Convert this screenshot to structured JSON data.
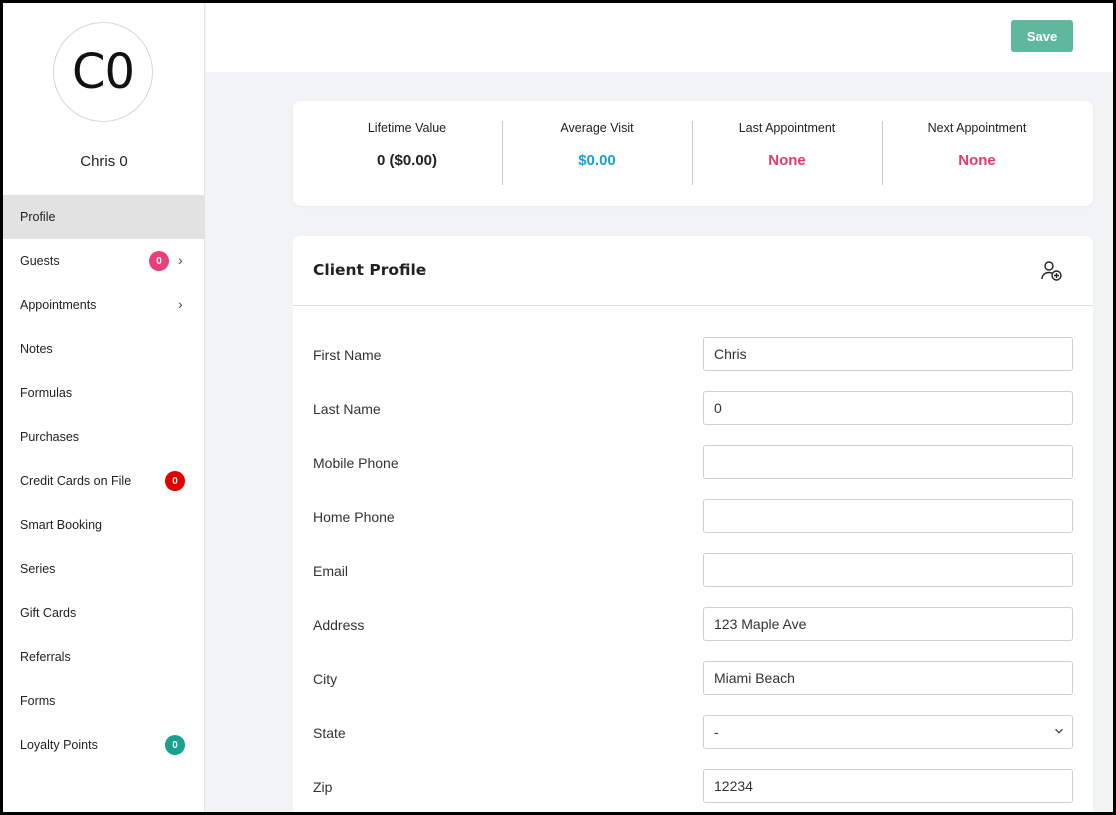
{
  "client": {
    "initials": "C0",
    "name": "Chris 0"
  },
  "sidebar": {
    "items": [
      {
        "label": "Profile"
      },
      {
        "label": "Guests",
        "badge": "0"
      },
      {
        "label": "Appointments"
      },
      {
        "label": "Notes"
      },
      {
        "label": "Formulas"
      },
      {
        "label": "Purchases"
      },
      {
        "label": "Credit Cards on File",
        "badge": "0"
      },
      {
        "label": "Smart Booking"
      },
      {
        "label": "Series"
      },
      {
        "label": "Gift Cards"
      },
      {
        "label": "Referrals"
      },
      {
        "label": "Forms"
      },
      {
        "label": "Loyalty Points",
        "badge": "0"
      }
    ]
  },
  "toolbar": {
    "save_label": "Save"
  },
  "stats": [
    {
      "label": "Lifetime Value",
      "value": "0 ($0.00)",
      "color": "#222222"
    },
    {
      "label": "Average Visit",
      "value": "$0.00",
      "color": "#1aa0d8"
    },
    {
      "label": "Last Appointment",
      "value": "None",
      "color": "#e23b6b"
    },
    {
      "label": "Next Appointment",
      "value": "None",
      "color": "#e23b6b"
    }
  ],
  "profile": {
    "title": "Client Profile",
    "fields": [
      {
        "label": "First Name",
        "value": "Chris"
      },
      {
        "label": "Last Name",
        "value": "0"
      },
      {
        "label": "Mobile Phone",
        "value": ""
      },
      {
        "label": "Home Phone",
        "value": ""
      },
      {
        "label": "Email",
        "value": ""
      },
      {
        "label": "Address",
        "value": "123 Maple Ave"
      },
      {
        "label": "City",
        "value": "Miami Beach"
      },
      {
        "label": "State",
        "value": "-"
      },
      {
        "label": "Zip",
        "value": "12234"
      }
    ]
  },
  "colors": {
    "accent": "#5fb89e",
    "badge_pink": "#e8407a",
    "badge_red": "#e00000",
    "badge_teal": "#17a28f"
  }
}
